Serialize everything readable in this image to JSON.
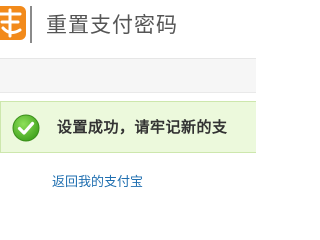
{
  "header": {
    "title": "重置支付密码",
    "logo_icon": "alipay-logo-icon"
  },
  "message": {
    "icon": "check-circle-icon",
    "text": "设置成功，请牢记新的支"
  },
  "links": {
    "back": "返回我的支付宝"
  },
  "colors": {
    "success_background": "#ecf9dc",
    "success_icon": "#5cb82e",
    "link": "#1f6fb0"
  }
}
